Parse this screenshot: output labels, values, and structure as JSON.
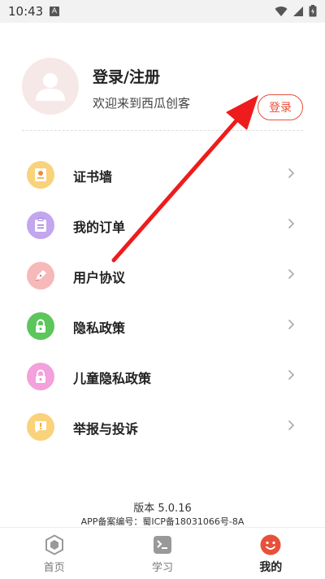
{
  "status": {
    "time": "10:43",
    "notif": "A"
  },
  "profile": {
    "title": "登录/注册",
    "subtitle": "欢迎来到西瓜创客",
    "login_button": "登录"
  },
  "menu": [
    {
      "label": "证书墙",
      "icon": "certificate-icon",
      "color": "#f7c96b"
    },
    {
      "label": "我的订单",
      "icon": "order-icon",
      "color": "#b99be8"
    },
    {
      "label": "用户协议",
      "icon": "pen-icon",
      "color": "#f2a6a6"
    },
    {
      "label": "隐私政策",
      "icon": "lock-icon",
      "color": "#5cc65c"
    },
    {
      "label": "儿童隐私政策",
      "icon": "lock-icon",
      "color": "#ef8fd3"
    },
    {
      "label": "举报与投诉",
      "icon": "alert-icon",
      "color": "#f7c96b"
    }
  ],
  "footer": {
    "version": "版本 5.0.16",
    "icp": "APP备案编号：蜀ICP备18031066号-8A"
  },
  "tabs": [
    {
      "label": "首页",
      "icon": "home-hexagon-icon",
      "active": false
    },
    {
      "label": "学习",
      "icon": "terminal-icon",
      "active": false
    },
    {
      "label": "我的",
      "icon": "smiley-icon",
      "active": true
    }
  ],
  "colors": {
    "accent": "#e8503a",
    "annotation_arrow": "#ee1c1c"
  }
}
